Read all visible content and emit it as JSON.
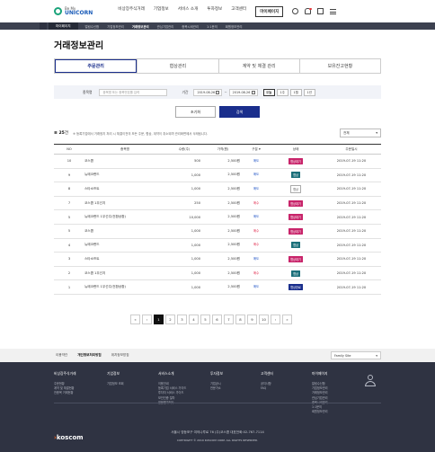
{
  "header": {
    "logo_line1": "Be My",
    "logo_line2": "UNICORN",
    "nav": [
      "비상장주식거래",
      "기업정보",
      "서비스 소개",
      "투자정보",
      "고객센터",
      "마이페이지"
    ],
    "icons": [
      "user-icon",
      "bell-icon",
      "document-icon",
      "menu-icon"
    ]
  },
  "subnav": {
    "dropdown": "마이페이지",
    "items": [
      "얼림수신함",
      "기업정보관리",
      "거래정보관리",
      "관심기업관리",
      "종목시세관리",
      "1:1문의",
      "회원정보관리"
    ],
    "active_index": 2
  },
  "page": {
    "title": "거래정보관리"
  },
  "tabs": [
    "주문관리",
    "협상관리",
    "계약 및 체결 관리",
    "보유잔고현황"
  ],
  "filter": {
    "stock_label": "종목명",
    "stock_placeholder": "종목명 또는 종목번호를 입력",
    "period_label": "기간",
    "date_from": "2019-08-26",
    "date_sep": "~",
    "date_to": "2019-08-26",
    "periods": [
      "오늘",
      "1주",
      "1월",
      "1년"
    ]
  },
  "buttons": {
    "reset": "초기화",
    "search": "검색"
  },
  "list": {
    "count": "25",
    "count_unit": "건",
    "notice": "※ 등록기업에서 거래정지 처리 시 체결이전의 모든 주문, 협상, 계약이 취소되며 관리화면에서 삭제됩니다.",
    "filter_value": "전체"
  },
  "table": {
    "headers": [
      "NO",
      "종목명",
      "수량(주)",
      "가격(원)",
      "구분",
      "상태",
      "주문일시"
    ],
    "rows": [
      {
        "no": "10",
        "name": "코스콤",
        "qty": "500",
        "price": "2,500원",
        "type": "매도",
        "status": "협상대기",
        "date": "2019-07-19 11:20"
      },
      {
        "no": "9",
        "name": "뉴에코랜드",
        "qty": "1,000",
        "price": "2,500원",
        "type": "매도",
        "status": "협상",
        "date": "2019-07-19 11:20"
      },
      {
        "no": "8",
        "name": "스타소프트",
        "qty": "1,000",
        "price": "2,500원",
        "type": "매도",
        "status": "협상",
        "date": "2019-07-19 11:20"
      },
      {
        "no": "7",
        "name": "코스콤 1우선지",
        "qty": "250",
        "price": "2,500원",
        "type": "매수",
        "status": "협상대기",
        "date": "2019-07-19 11:20"
      },
      {
        "no": "5",
        "name": "뉴에코랜드 1우선주(전환상환)",
        "qty": "10,000",
        "price": "2,500원",
        "type": "매도",
        "status": "협상대기",
        "date": "2019-07-19 11:20"
      },
      {
        "no": "5",
        "name": "코스콤",
        "qty": "1,000",
        "price": "2,500원",
        "type": "매수",
        "status": "협상대기",
        "date": "2019-07-19 11:20"
      },
      {
        "no": "4",
        "name": "뉴에코랜드",
        "qty": "1,000",
        "price": "2,500원",
        "type": "매수",
        "status": "협상",
        "date": "2019-07-19 11:20"
      },
      {
        "no": "3",
        "name": "스타소프트",
        "qty": "1,000",
        "price": "2,500원",
        "type": "매도",
        "status": "협상대기",
        "date": "2019-07-19 11:20"
      },
      {
        "no": "2",
        "name": "코스콤 1우선지",
        "qty": "1,000",
        "price": "2,500원",
        "type": "매수",
        "status": "협상",
        "date": "2019-07-19 11:20"
      },
      {
        "no": "1",
        "name": "뉴에코랜드 1우선주(전환상환)",
        "qty": "1,000",
        "price": "2,500원",
        "type": "매도",
        "status": "협상완료",
        "date": "2019-07-19 11:20"
      }
    ]
  },
  "pagination": {
    "first": "«",
    "prev": "‹",
    "pages": [
      "1",
      "2",
      "3",
      "4",
      "5",
      "6",
      "7",
      "8",
      "9",
      "10"
    ],
    "current": "1",
    "next": "›",
    "last": "»"
  },
  "footer": {
    "links": [
      "이용약관",
      "개인정보처리방침",
      "위치정보방침"
    ],
    "family_site": "Family Site",
    "columns": [
      {
        "title": "비상장주식거래",
        "items": [
          "주문현황",
          "계약 및 체결현황",
          "전종목 거래현황"
        ]
      },
      {
        "title": "기업정보",
        "items": [
          "기업정보 조회"
        ]
      },
      {
        "title": "서비스소개",
        "items": [
          "이용안내",
          "등록기업 서비스 가이드",
          "투자자 서비스 가이드",
          "보안인증 절차",
          "전문평가회사"
        ]
      },
      {
        "title": "투자정보",
        "items": [
          "기업공시",
          "전문가소"
        ]
      },
      {
        "title": "고객센터",
        "items": [
          "공지사항",
          "FAQ"
        ]
      },
      {
        "title": "마이페이지",
        "items": [
          "알림수신함",
          "기업정보관리",
          "거래정보관리",
          "관심기업관리",
          "종목시세관리",
          "1:1문의",
          "회원정보관리"
        ]
      }
    ],
    "brand": "koscom",
    "address": "서울시 영등포구 여의나루로 76 (주)코스콤    대표전화:02-767-7114",
    "copyright": "COPYRIGHT © 2019 KOSCOM CORP. ALL RIGHTS RESERVED."
  }
}
